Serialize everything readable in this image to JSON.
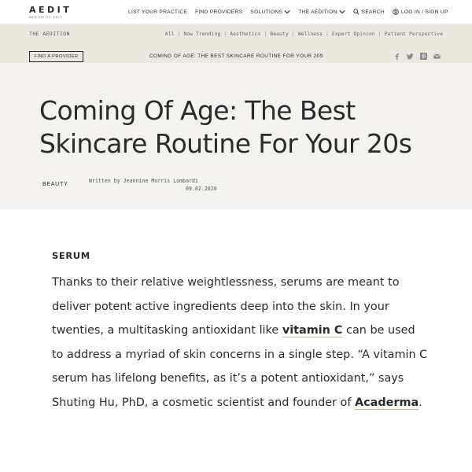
{
  "brand": {
    "name": "AEDIT",
    "tagline": "AESTHETIC EDIT"
  },
  "topnav": {
    "items": [
      {
        "label": "LIST YOUR PRACTICE"
      },
      {
        "label": "FIND PROVIDERS"
      },
      {
        "label": "SOLUTIONS",
        "icon": "chevron-down-icon"
      },
      {
        "label": "THE AEDITION",
        "icon": "chevron-down-icon"
      },
      {
        "label": "SEARCH",
        "icon": "search-icon"
      },
      {
        "label": "LOG IN / SIGN UP",
        "icon": "user-icon"
      }
    ]
  },
  "edition_bar": {
    "title": "THE AEDITION",
    "categories": [
      "All",
      "Now Trending",
      "Aesthetics",
      "Beauty",
      "Wellness",
      "Expert Opinion",
      "Patient Perspective"
    ],
    "separator": "|",
    "find_provider_label": "FIND A PROVIDER",
    "crumb_title": "COMING OF AGE: THE BEST SKINCARE ROUTINE FOR YOUR 20S",
    "share_icons": [
      "facebook-icon",
      "twitter-icon",
      "pinterest-icon",
      "email-icon"
    ]
  },
  "article": {
    "headline": "Coming Of Age:  The Best Skincare Routine For Your 20s",
    "category": "BEAUTY",
    "byline": "Written by Jeannine Morris Lombardi",
    "date": "09.02.2020",
    "section_heading": "SERUM",
    "paragraph": {
      "part1": "Thanks to their relative weightlessness, serums are meant to deliver potent active ingredients deep into the skin. In your twenties, a multitasking antioxidant like ",
      "link1": "vitamin C",
      "part2": " can be used to address a myriad of skin concerns in a single step. “A vitamin C serum has lifelong benefits, as it’s a potent antioxidant,” says Shuting Hu, PhD, a cosmetic scientist and founder of ",
      "link2": "Acaderma",
      "part3": "."
    }
  },
  "colors": {
    "text": "#2b2b2b",
    "edition_bar_bg": "#ebe8df",
    "hero_bg": "#f4f3f0",
    "link_underline": "#c9b98a"
  }
}
